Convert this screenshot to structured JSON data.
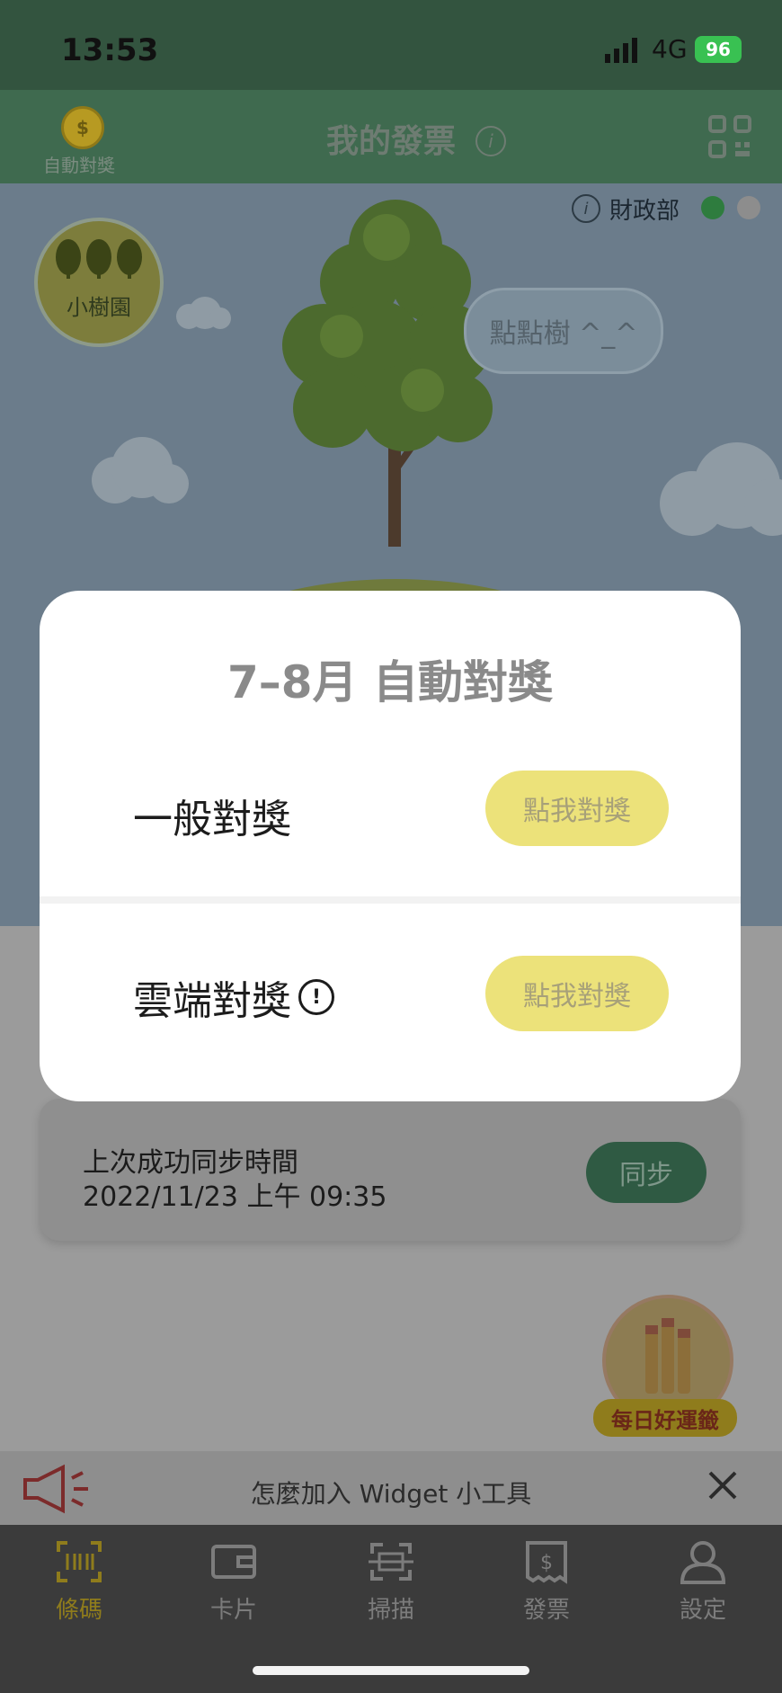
{
  "status_bar": {
    "time": "13:53",
    "network": "4G",
    "battery": "96"
  },
  "header": {
    "auto_label": "自動對獎",
    "title": "我的發票",
    "info_icon": "info-icon",
    "qr_icon": "qr-code-icon"
  },
  "scene": {
    "gov_label": "財政部",
    "grove_label": "小樹園",
    "bubble_text": "點點樹 ^_^"
  },
  "sync": {
    "line1": "上次成功同步時間",
    "line2": "2022/11/23 上午 09:35",
    "button": "同步"
  },
  "fortune": {
    "label": "每日好運籤"
  },
  "widget_bar": {
    "text": "怎麼加入 Widget 小工具"
  },
  "tabs": [
    {
      "label": "條碼",
      "icon": "barcode-icon",
      "active": true
    },
    {
      "label": "卡片",
      "icon": "wallet-icon",
      "active": false
    },
    {
      "label": "掃描",
      "icon": "scan-icon",
      "active": false
    },
    {
      "label": "發票",
      "icon": "receipt-icon",
      "active": false
    },
    {
      "label": "設定",
      "icon": "user-icon",
      "active": false
    }
  ],
  "modal": {
    "title": "7–8月 自動對獎",
    "rows": [
      {
        "label": "一般對獎",
        "button": "點我對獎"
      },
      {
        "label": "雲端對獎",
        "button": "點我對獎"
      }
    ]
  },
  "colors": {
    "accent_yellow": "#ece27a",
    "header_green": "#3f6a4f"
  }
}
